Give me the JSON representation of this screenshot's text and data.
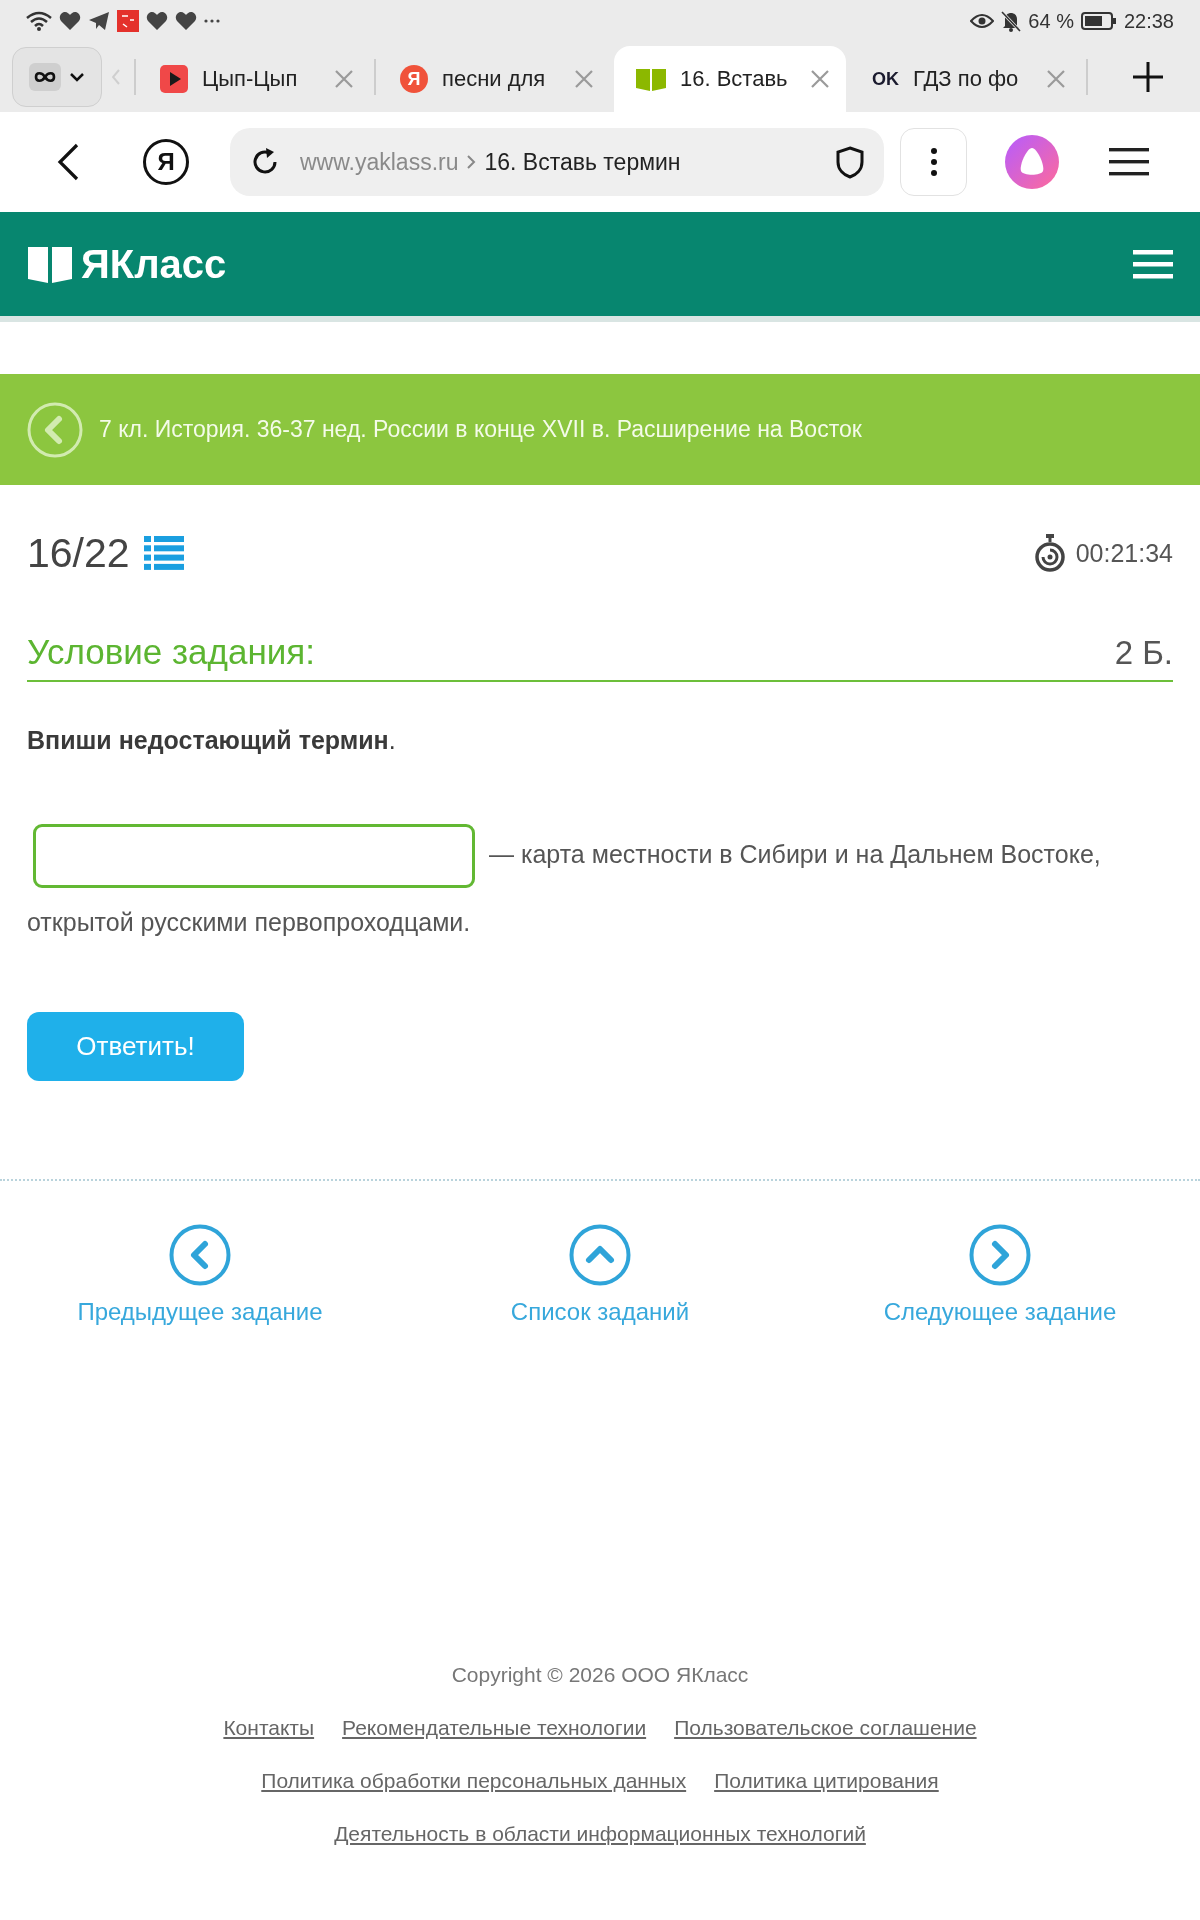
{
  "status_bar": {
    "battery": "64 %",
    "time": "22:38"
  },
  "tabs": [
    {
      "title": "Цып-Цып",
      "kind": "video",
      "selected": false
    },
    {
      "title": "песни для",
      "kind": "letter_round",
      "icon_text": "Я",
      "selected": false
    },
    {
      "title": "16. Вставь",
      "kind": "book",
      "selected": true
    },
    {
      "title": "ГДЗ по фо",
      "kind": "letter_text",
      "icon_text": "OK",
      "selected": false
    }
  ],
  "address_bar": {
    "browser_button": "Я",
    "host": "www.yaklass.ru",
    "page_title": "16. Вставь термин"
  },
  "site_header": {
    "logo": "ЯКласс"
  },
  "breadcrumb": "7 кл. История. 36-37 нед. России в конце XVII в. Расширение на Восток",
  "task": {
    "counter": "16/22",
    "timer": "00:21:34",
    "section_title": "Условие задания:",
    "points": "2 Б.",
    "instruction": "**Впиши недостающий термин**.",
    "sentence": [
      {
        "kind": "blank"
      },
      {
        "kind": "text",
        "text": "— карта местности в Сибири и на Дальнем Востоке,"
      },
      {
        "kind": "text",
        "text": "открытой русскими первопроходцами."
      }
    ],
    "submit": "Ответить!"
  },
  "navigation": [
    {
      "kind": "previous",
      "label": "Предыдущее задание"
    },
    {
      "kind": "list",
      "label": "Список заданий"
    },
    {
      "kind": "next",
      "label": "Следующее задание"
    }
  ],
  "footer": {
    "copyright": "Copyright © 2026 ООО ЯКласс",
    "link_rows": [
      [
        "Контакты",
        "Рекомендательные технологии",
        "Пользовательское соглашение"
      ],
      [
        "Политика обработки персональных данных",
        "Политика цитирования"
      ],
      [
        "Деятельность в области информационных технологий"
      ]
    ]
  }
}
